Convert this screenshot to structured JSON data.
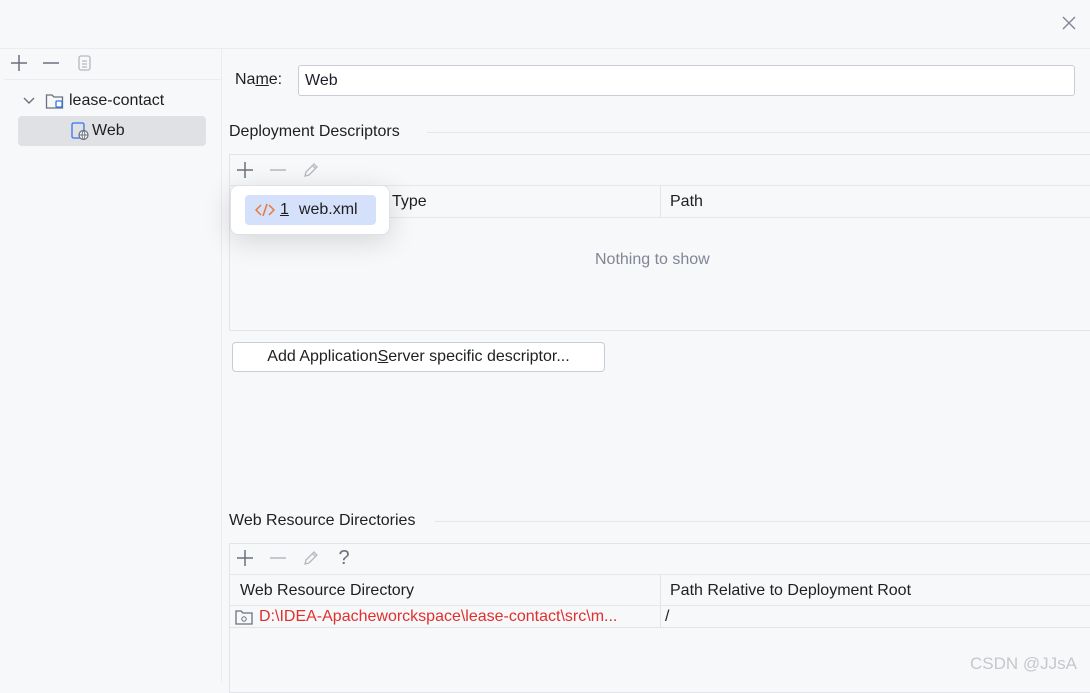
{
  "dialog": {
    "close_icon": "close-icon"
  },
  "sidebar": {
    "toolbar": {
      "add_icon": "plus-icon",
      "remove_icon": "minus-icon",
      "copy_icon": "copy-icon"
    },
    "tree": [
      {
        "label": "lease-contact",
        "icon": "module-folder-icon",
        "expanded": true
      },
      {
        "label": "Web",
        "icon": "web-facet-icon",
        "selected": true
      }
    ]
  },
  "name_field": {
    "label_pre": "Na",
    "label_mnemonic": "m",
    "label_post": "e:",
    "value": "Web"
  },
  "deployment_descriptors": {
    "title": "Deployment Descriptors",
    "toolbar": {
      "add_icon": "plus-icon",
      "remove_icon": "minus-icon",
      "edit_icon": "pencil-icon"
    },
    "columns": [
      "Type",
      "Path"
    ],
    "empty_text": "Nothing to show",
    "add_button": {
      "label_pre": "Add Application ",
      "label_mnemonic": "S",
      "label_post": "erver specific descriptor..."
    },
    "popup": {
      "items": [
        {
          "number": "1",
          "label": "web.xml",
          "icon": "xml-code-icon"
        }
      ]
    }
  },
  "web_resource_directories": {
    "title": "Web Resource Directories",
    "toolbar": {
      "add_icon": "plus-icon",
      "remove_icon": "minus-icon",
      "edit_icon": "pencil-icon",
      "help_icon": "question-icon"
    },
    "columns": [
      "Web Resource Directory",
      "Path Relative to Deployment Root"
    ],
    "rows": [
      {
        "directory": "D:\\IDEA-Apacheworckspace\\lease-contact\\src\\m...",
        "relative_path": "/"
      }
    ]
  },
  "watermark": "CSDN @JJsA",
  "colors": {
    "background": "#f7f8fa",
    "selection": "#dfe1e5",
    "popup_selection": "#d5e1fb",
    "error_text": "#e0302d",
    "xml_icon": "#e8783a"
  }
}
